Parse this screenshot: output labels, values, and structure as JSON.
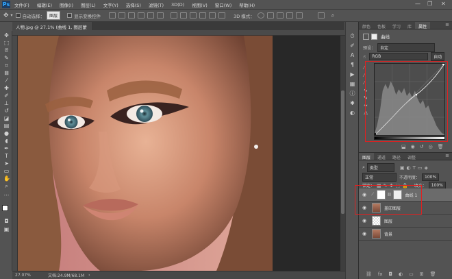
{
  "menu": {
    "logo": "Ps",
    "items": [
      "文件(F)",
      "编辑(E)",
      "图像(I)",
      "图层(L)",
      "文字(Y)",
      "选择(S)",
      "滤镜(T)",
      "3D(D)",
      "视图(V)",
      "窗口(W)",
      "帮助(H)"
    ],
    "minimize": "—",
    "restore": "❐",
    "close": "✕"
  },
  "options": {
    "auto_select_label": "自动选择：",
    "auto_select_value": "图层",
    "show_transform_label": "显示变换控件",
    "threed_mode_label": "3D 模式："
  },
  "document": {
    "tab_title": "人物.jpg @ 27.1% (曲线 1, 图层蒙版/8) *",
    "zoom": "27.07%",
    "doc_size": "文档:24.9M/68.1M"
  },
  "properties": {
    "tabs": [
      "颜色",
      "色板",
      "学习",
      "库",
      "属性"
    ],
    "active_tab": "属性",
    "title": "曲线",
    "preset_label": "预设：",
    "preset_value": "自定",
    "channel_value": "RGB",
    "auto_button": "自动"
  },
  "layers": {
    "tabs": [
      "图层",
      "通道",
      "路径",
      "调整"
    ],
    "active_tab": "图层",
    "kind_filter": "类型",
    "blend_mode": "正常",
    "opacity_label": "不透明度：",
    "opacity_value": "100%",
    "lock_label": "锁定：",
    "fill_label": "填充：",
    "fill_value": "100%",
    "items": [
      {
        "name": "曲线 1",
        "kind": "adjustment"
      },
      {
        "name": "盖印图层",
        "kind": "photo"
      },
      {
        "name": "图层",
        "kind": "blank"
      },
      {
        "name": "背景",
        "kind": "photo"
      }
    ]
  },
  "colors": {
    "highlight_red": "#e02020",
    "panel_bg": "#535353",
    "canvas_bg": "#282828"
  }
}
